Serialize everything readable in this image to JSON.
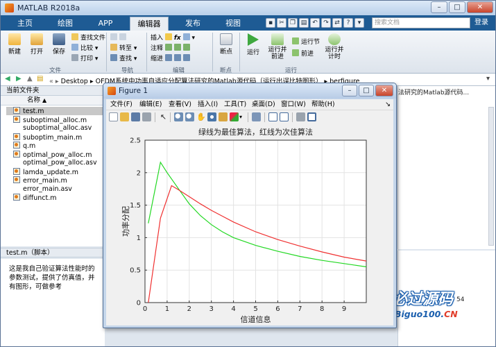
{
  "main_window": {
    "title": "MATLAB R2018a",
    "controls": [
      "–",
      "□",
      "✕"
    ]
  },
  "ribbon": {
    "tabs": [
      "主页",
      "绘图",
      "APP",
      "编辑器",
      "发布",
      "视图"
    ],
    "active_tab": "编辑器",
    "search_placeholder": "搜索文档",
    "login": "登录",
    "file_group": {
      "label": "文件",
      "new": "新建",
      "open": "打开",
      "save": "保存",
      "find_files": "查找文件",
      "compare": "比较",
      "print": "打印"
    },
    "nav_group": {
      "label": "导航",
      "goto": "转至",
      "find": "查找"
    },
    "edit_group": {
      "label": "编辑",
      "insert": "插入",
      "comment": "注释",
      "indent": "缩进",
      "fx": "fx"
    },
    "breakpoint_group": {
      "label": "断点",
      "breakpoints": "断点"
    },
    "run_group": {
      "label": "运行",
      "run": "运行",
      "run_advance": "运行并前进",
      "run_section": "运行节",
      "advance": "前进",
      "run_time": "运行并计时"
    }
  },
  "address": {
    "crumbs": [
      "Desktop",
      "OFDM系统中功率自适应分配算法研究的Matlab源代码（运行出误比特图形）",
      "berfigure"
    ]
  },
  "current_folder": {
    "header": "当前文件夹",
    "column_name": "名称",
    "sort_indicator": "▲",
    "files": [
      "test.m",
      "suboptimal_alloc.m",
      "suboptimal_alloc.asv",
      "suboptim_main.m",
      "q.m",
      "optimal_pow_alloc.m",
      "optimal_pow_alloc.asv",
      "lamda_update.m",
      "error_main.m",
      "error_main.asv",
      "diffunct.m"
    ],
    "selected": "test.m"
  },
  "details": {
    "header": "test.m（脚本）",
    "text": "这是我自己验证算法性能时的参数测试，提供了仿真值，并有图形，可做参考"
  },
  "right_panel": {
    "text": "法研究的Matlab源代码..."
  },
  "command_bg": {
    "number": "54"
  },
  "watermark": {
    "main": "必过源码",
    "sub_blue": "Biguo100.",
    "sub_red": "CN"
  },
  "figure": {
    "title": "Figure 1",
    "controls": [
      "–",
      "□",
      "✕"
    ],
    "menu": [
      "文件(F)",
      "编辑(E)",
      "查看(V)",
      "插入(I)",
      "工具(T)",
      "桌面(D)",
      "窗口(W)",
      "帮助(H)"
    ],
    "menu_arrow": "↘"
  },
  "colors": {
    "green_series": "#22d822",
    "red_series": "#f03030",
    "ribbon_blue": "#1e5b94"
  },
  "chart_data": {
    "type": "line",
    "title": "绿线为最佳算法，红线为次佳算法",
    "xlabel": "信道信息",
    "ylabel": "功率分配",
    "xlim": [
      0,
      10
    ],
    "ylim": [
      0,
      2.5
    ],
    "xticks": [
      0,
      1,
      2,
      3,
      4,
      5,
      6,
      7,
      8,
      9
    ],
    "yticks": [
      0,
      0.5,
      1,
      1.5,
      2,
      2.5
    ],
    "grid": true,
    "series": [
      {
        "color": "#22d822",
        "x": [
          0.15,
          0.7,
          1.0,
          1.5,
          2,
          2.5,
          3,
          3.5,
          4,
          5,
          6,
          7,
          8,
          9,
          10
        ],
        "y": [
          1.22,
          2.16,
          2.0,
          1.76,
          1.52,
          1.34,
          1.2,
          1.09,
          1.0,
          0.88,
          0.79,
          0.71,
          0.65,
          0.6,
          0.55
        ]
      },
      {
        "color": "#f03030",
        "x": [
          0.15,
          0.7,
          1.2,
          1.5,
          2,
          2.5,
          3,
          3.5,
          4,
          5,
          6,
          7,
          8,
          9,
          10
        ],
        "y": [
          0.0,
          1.3,
          1.8,
          1.74,
          1.63,
          1.52,
          1.42,
          1.33,
          1.24,
          1.09,
          0.97,
          0.87,
          0.78,
          0.7,
          0.64
        ]
      }
    ]
  }
}
